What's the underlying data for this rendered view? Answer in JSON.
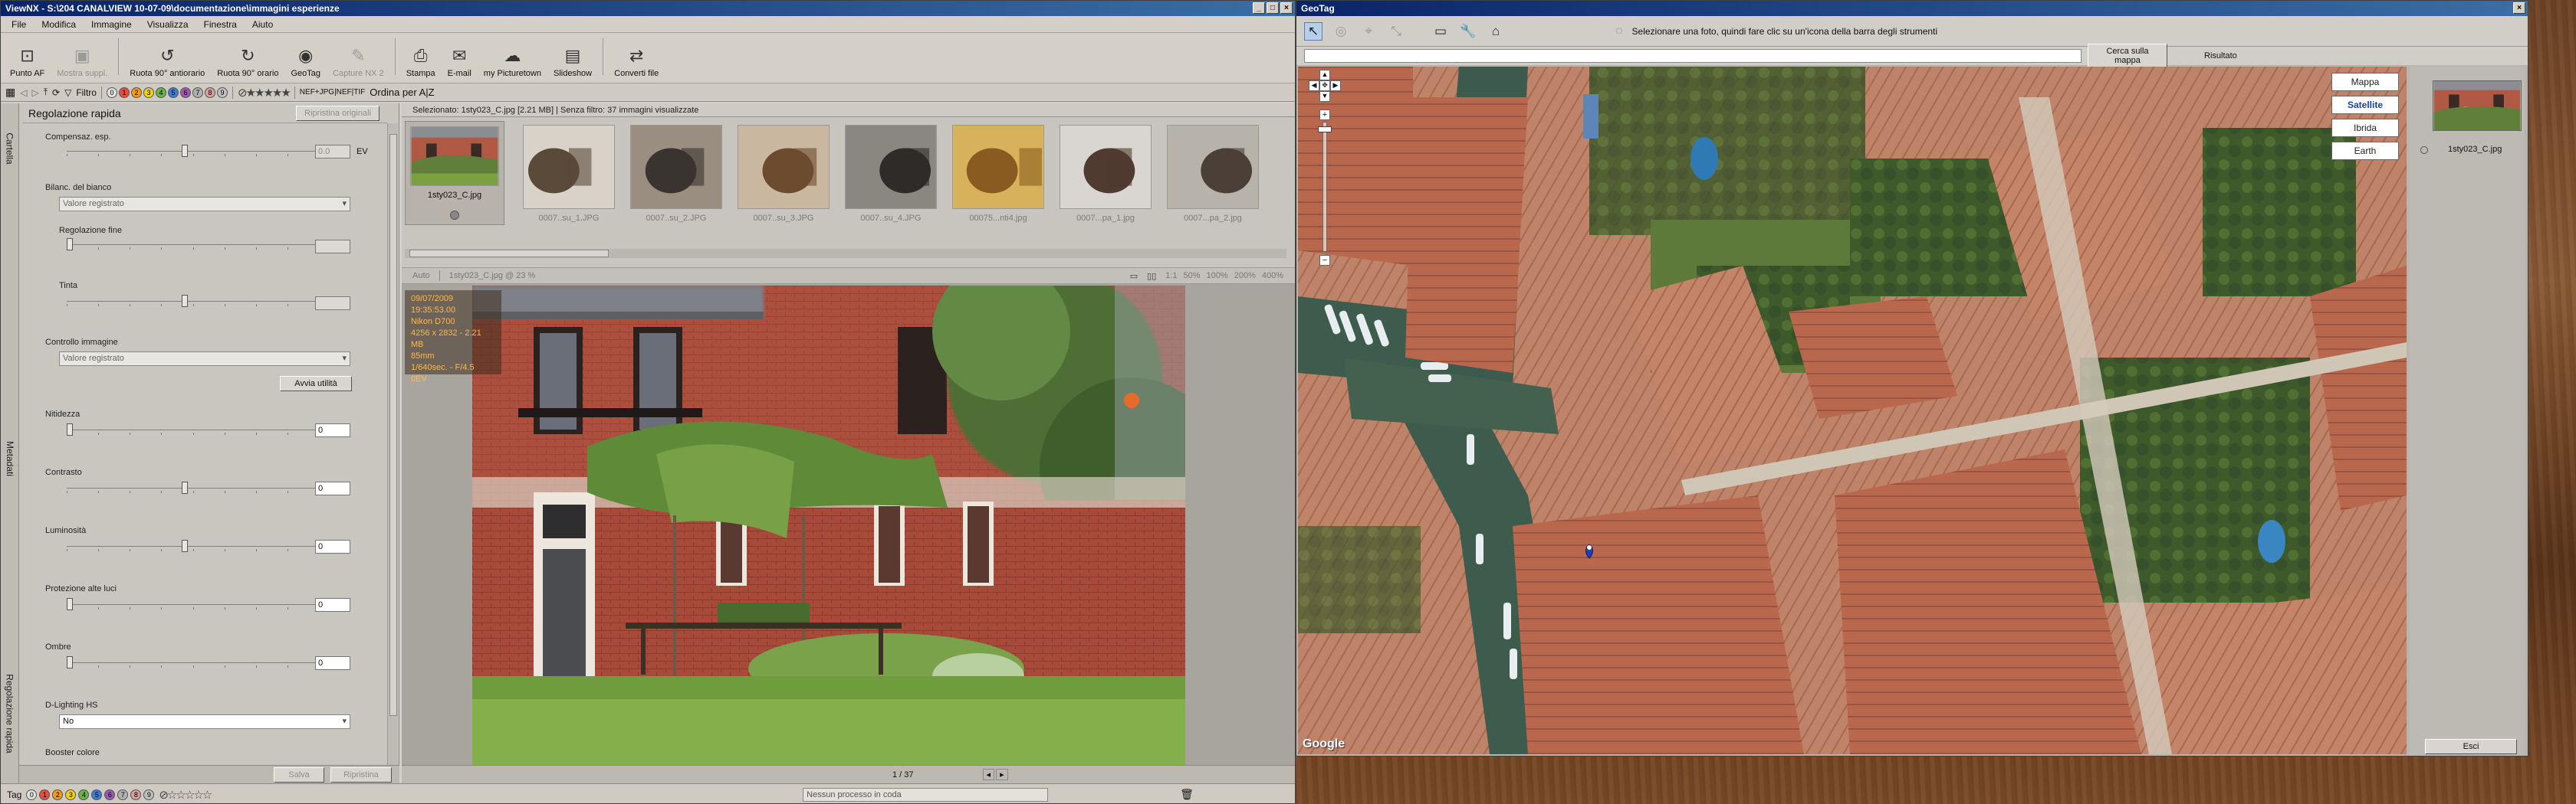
{
  "viewnx": {
    "title": "ViewNX - S:\\204 CANALVIEW 10-07-09\\documentazione\\immagini esperienze",
    "menu": [
      "File",
      "Modifica",
      "Immagine",
      "Visualizza",
      "Finestra",
      "Aiuto"
    ],
    "toolbar": [
      {
        "label": "Punto AF",
        "icon": "af-point-icon",
        "enabled": true
      },
      {
        "label": "Mostra suppl.",
        "icon": "overlay-icon",
        "enabled": false
      },
      {
        "label": "Ruota 90° antiorario",
        "icon": "rotate-left-icon",
        "enabled": true
      },
      {
        "label": "Ruota 90° orario",
        "icon": "rotate-right-icon",
        "enabled": true
      },
      {
        "label": "GeoTag",
        "icon": "geotag-icon",
        "enabled": true
      },
      {
        "label": "Capture NX 2",
        "icon": "capture-nx-icon",
        "enabled": false
      },
      {
        "label": "Stampa",
        "icon": "print-icon",
        "enabled": true
      },
      {
        "label": "E-mail",
        "icon": "email-icon",
        "enabled": true
      },
      {
        "label": "my Picturetown",
        "icon": "picturetown-icon",
        "enabled": true
      },
      {
        "label": "Slideshow",
        "icon": "slideshow-icon",
        "enabled": true
      },
      {
        "label": "Converti file",
        "icon": "convert-icon",
        "enabled": true
      }
    ],
    "filterbar": {
      "filter_label": "Filtro",
      "labels": [
        "0",
        "1",
        "2",
        "3",
        "4",
        "5",
        "6",
        "7",
        "8",
        "9"
      ],
      "format": "NEF+JPG|NEF|TIF",
      "sort": "Ordina per A|Z"
    },
    "side_tabs": [
      "Cartella",
      "Metadati",
      "Regolazione rapida"
    ],
    "panel": {
      "title": "Regolazione rapida",
      "reset_label": "Ripristina originali",
      "exp_label": "Compensaz. esp.",
      "exp_value": "0.0",
      "exp_unit": "EV",
      "wb_label": "Bilanc. del bianco",
      "wb_value": "Valore registrato",
      "fine_label": "Regolazione fine",
      "tint_label": "Tinta",
      "picture_control_label": "Controllo immagine",
      "picture_control_value": "Valore registrato",
      "launch_utility": "Avvia utilità",
      "sharpness_label": "Nitidezza",
      "sharpness_value": "0",
      "contrast_label": "Contrasto",
      "contrast_value": "0",
      "brightness_label": "Luminosità",
      "brightness_value": "0",
      "highlight_label": "Protezione alte luci",
      "highlight_value": "0",
      "shadows_label": "Ombre",
      "shadows_value": "0",
      "dlighting_label": "D-Lighting HS",
      "dlighting_value": "No",
      "booster_label": "Booster colore",
      "save_label": "Salva",
      "restore_label": "Ripristina"
    },
    "selection_info": "Selezionato: 1sty023_C.jpg [2.21 MB] | Senza filtro: 37 immagini visualizzate",
    "thumbnails": [
      {
        "name": "1sty023_C.jpg",
        "selected": true
      },
      {
        "name": "0007..su_1.JPG",
        "selected": false
      },
      {
        "name": "0007..su_2.JPG",
        "selected": false
      },
      {
        "name": "0007..su_3.JPG",
        "selected": false
      },
      {
        "name": "0007..su_4.JPG",
        "selected": false
      },
      {
        "name": "00075...nti4.jpg",
        "selected": false
      },
      {
        "name": "0007...pa_1.jpg",
        "selected": false
      },
      {
        "name": "0007...pa_2.jpg",
        "selected": false
      }
    ],
    "viewbar": {
      "auto": "Auto",
      "file_zoom": "1sty023_C.jpg @ 23 %",
      "zooms": [
        "1:1",
        "50%",
        "100%",
        "200%",
        "400%"
      ]
    },
    "info_overlay": {
      "date": "09/07/2009 19:35:53.00",
      "camera": "Nikon D700",
      "size": "4256 x 2832 - 2.21 MB",
      "focal": "85mm",
      "exposure": "1/640sec. - F/4.5",
      "ev": "0EV"
    },
    "footer": {
      "page": "1 / 37",
      "process": "Nessun processo in coda"
    },
    "bottom": {
      "tag_label": "Tag",
      "labels": [
        "0",
        "1",
        "2",
        "3",
        "4",
        "5",
        "6",
        "7",
        "8",
        "9"
      ]
    }
  },
  "geotag": {
    "title": "GeoTag",
    "hint": "Selezionare una foto, quindi fare clic su un'icona della barra degli strumenti",
    "search_button": "Cerca sulla mappa",
    "result_label": "Risultato",
    "map_types": [
      {
        "label": "Mappa",
        "active": false
      },
      {
        "label": "Satellite",
        "active": true
      },
      {
        "label": "Ibrida",
        "active": false
      },
      {
        "label": "Earth",
        "active": false
      }
    ],
    "thumbnail_name": "1sty023_C.jpg",
    "exit_label": "Esci",
    "google": "Google"
  }
}
